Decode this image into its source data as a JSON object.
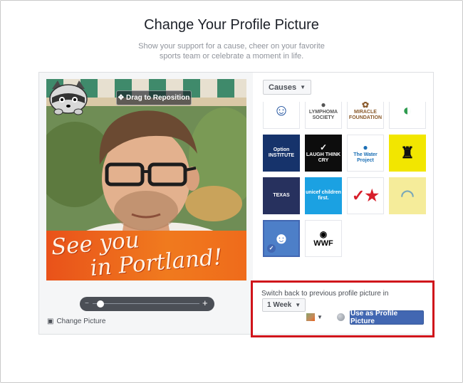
{
  "header": {
    "title": "Change Your Profile Picture",
    "subtitle_line1": "Show your support for a cause, cheer on your favorite",
    "subtitle_line2": "sports team or celebrate a moment in life."
  },
  "editor": {
    "drag_label": "Drag to Reposition",
    "overlay_line1": "See you",
    "overlay_line2": "in Portland!",
    "change_picture_label": "Change Picture",
    "zoom_level": 0.05,
    "zoom_minus": "−",
    "zoom_plus": "+"
  },
  "frames": {
    "category_label": "Causes",
    "tiles": [
      {
        "label": "",
        "bg": "#ffffff",
        "fg": "#1c4f9c",
        "icon": "portrait-icon"
      },
      {
        "label": "LYMPHOMA SOCIETY",
        "bg": "#ffffff",
        "fg": "#555555",
        "icon": "drop-icon"
      },
      {
        "label": "MIRACLE FOUNDATION",
        "bg": "#ffffff",
        "fg": "#8a5a2b",
        "icon": "flower-icon"
      },
      {
        "label": "",
        "bg": "#ffffff",
        "fg": "#2e9b4f",
        "icon": "globe-leaf-icon"
      },
      {
        "label": "Option INSTITUTE",
        "bg": "#16336b",
        "fg": "#ffffff",
        "icon": ""
      },
      {
        "label": "LAUGH THINK CRY",
        "bg": "#0d0d0d",
        "fg": "#ffffff",
        "icon": "signature-icon"
      },
      {
        "label": "The Water Project",
        "bg": "#ffffff",
        "fg": "#1b6fb5",
        "icon": "drop-icon"
      },
      {
        "label": "",
        "bg": "#f2e600",
        "fg": "#111111",
        "icon": "ghost-icon"
      },
      {
        "label": "TEXAS",
        "bg": "#27315e",
        "fg": "#ffffff",
        "icon": ""
      },
      {
        "label": "unicef children first.",
        "bg": "#1ba1e2",
        "fg": "#ffffff",
        "icon": ""
      },
      {
        "label": "",
        "bg": "#ffffff",
        "fg": "#d71f2b",
        "icon": "check-star-icon"
      },
      {
        "label": "",
        "bg": "#f5ec9a",
        "fg": "#7aa8b8",
        "icon": "hat-icon"
      },
      {
        "label": "",
        "bg": "#4d7fc8",
        "fg": "#ffffff",
        "icon": "raccoon-icon",
        "selected": true
      },
      {
        "label": "WWF",
        "bg": "#ffffff",
        "fg": "#000000",
        "icon": "panda-icon"
      }
    ]
  },
  "footer": {
    "switch_back_label": "Switch back to previous profile picture in",
    "duration_value": "1 Week",
    "use_button_label": "Use as Profile Picture"
  },
  "colors": {
    "primary_button": "#4267b2",
    "highlight_box": "#d0141b",
    "overlay_orange": "#ef6b1b"
  }
}
